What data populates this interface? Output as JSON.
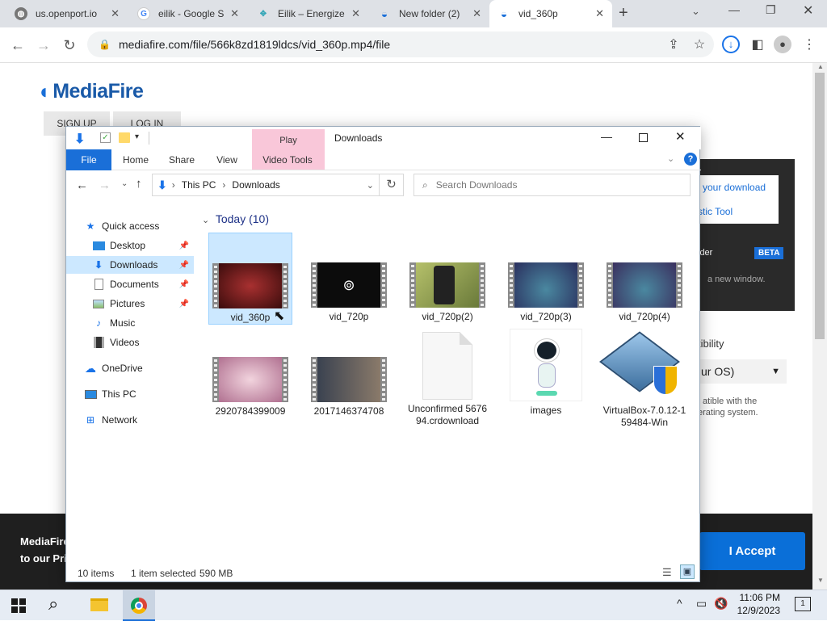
{
  "browser": {
    "tabs": [
      {
        "title": "us.openport.io",
        "icon": "globe-icon",
        "active": false
      },
      {
        "title": "eilik - Google S",
        "icon": "google-icon",
        "active": false
      },
      {
        "title": "Eilik – Energize",
        "icon": "eilik-icon",
        "active": false
      },
      {
        "title": "New folder (2)",
        "icon": "mediafire-icon",
        "active": false
      },
      {
        "title": "vid_360p",
        "icon": "mediafire-icon",
        "active": true
      }
    ],
    "url": "mediafire.com/file/566k8zd1819ldcs/vid_360p.mp4/file"
  },
  "mediafire": {
    "logo": "MediaFire",
    "sign_up": "SIGN UP",
    "log_in": "LOG IN",
    "panel": {
      "your_download": "your download",
      "tool": "stic Tool",
      "folder": "lder",
      "beta": "BETA",
      "new_window": "a new window.",
      "compat": "tibility",
      "os_select": "ur OS)",
      "compat_note1": "atible with the",
      "compat_note2": "erating system."
    },
    "cookie": {
      "line1": "MediaFire",
      "line2": "to our Priv",
      "accept": "I Accept"
    }
  },
  "explorer": {
    "title": "Downloads",
    "ribbon_tabs": [
      "File",
      "Home",
      "Share",
      "View"
    ],
    "play_label": "Play",
    "video_tools": "Video Tools",
    "path": [
      "This PC",
      "Downloads"
    ],
    "search_placeholder": "Search Downloads",
    "sidebar": [
      {
        "label": "Quick access",
        "icon": "star-icon",
        "pinned": false
      },
      {
        "label": "Desktop",
        "icon": "desktop-icon",
        "pinned": true
      },
      {
        "label": "Downloads",
        "icon": "download-icon",
        "pinned": true,
        "selected": true
      },
      {
        "label": "Documents",
        "icon": "document-icon",
        "pinned": true
      },
      {
        "label": "Pictures",
        "icon": "pictures-icon",
        "pinned": true
      },
      {
        "label": "Music",
        "icon": "music-icon",
        "pinned": false
      },
      {
        "label": "Videos",
        "icon": "videos-icon",
        "pinned": false
      },
      {
        "label": "OneDrive",
        "icon": "cloud-icon",
        "pinned": false
      },
      {
        "label": "This PC",
        "icon": "computer-icon",
        "pinned": false
      },
      {
        "label": "Network",
        "icon": "network-icon",
        "pinned": false
      }
    ],
    "group_header": "Today (10)",
    "files": [
      {
        "name": "vid_360p",
        "kind": "video",
        "thumb": "#5a1414",
        "selected": true
      },
      {
        "name": "vid_720p",
        "kind": "video",
        "thumb": "#0c0c0c"
      },
      {
        "name": "vid_720p(2)",
        "kind": "video",
        "thumb": "#8a9a4a"
      },
      {
        "name": "vid_720p(3)",
        "kind": "video",
        "thumb": "#2f3e6e"
      },
      {
        "name": "vid_720p(4)",
        "kind": "video",
        "thumb": "#3a3760"
      },
      {
        "name": "2920784399009",
        "kind": "video",
        "thumb": "#d9a3b8"
      },
      {
        "name": "2017146374708",
        "kind": "video",
        "thumb": "#4d5660"
      },
      {
        "name": "Unconfirmed 567694.crdownload",
        "kind": "blank"
      },
      {
        "name": "images",
        "kind": "robot"
      },
      {
        "name": "VirtualBox-7.0.12-159484-Win",
        "kind": "vbox"
      }
    ],
    "status": {
      "count": "10 items",
      "selected": "1 item selected",
      "size": "590 MB"
    }
  },
  "taskbar": {
    "time": "11:06 PM",
    "date": "12/9/2023",
    "notifications": "1"
  }
}
